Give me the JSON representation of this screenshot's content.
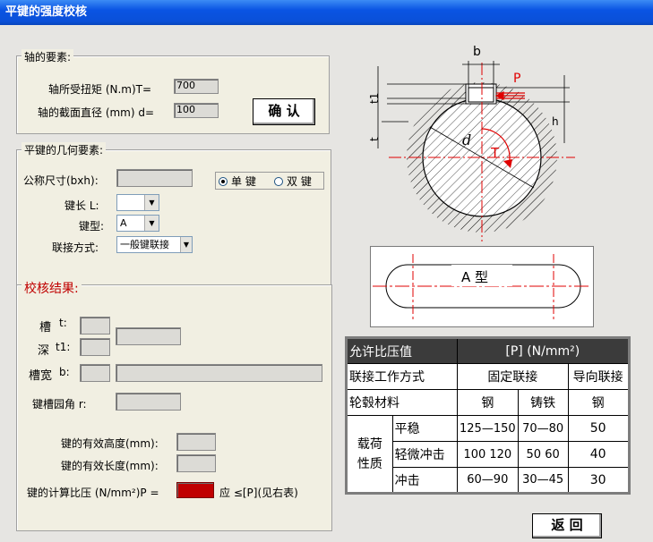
{
  "window": {
    "title": "平键的强度校核"
  },
  "shaft_group": {
    "label": "轴的要素:",
    "torque_label": "轴所受扭矩 (N.m)T=",
    "torque_value": "700",
    "diameter_label": "轴的截面直径 (mm) d=",
    "diameter_value": "100",
    "confirm_label": "确 认"
  },
  "key_group": {
    "label": "平键的几何要素:",
    "nominal_size_label": "公称尺寸(bxh):",
    "nominal_size_value": "",
    "length_label": "键长 L:",
    "length_value": "",
    "type_label": "键型:",
    "type_value": "A",
    "connection_label": "联接方式:",
    "connection_value": "一般键联接",
    "radio_single": "单 键",
    "radio_double": "双 键"
  },
  "result_group": {
    "label": "校核结果:",
    "groove_label_1": "槽",
    "groove_t_label": "t:",
    "depth_label": "深",
    "groove_t1_label": "t1:",
    "width_label": "槽宽",
    "width_b_label": "b:",
    "fillet_label": "键槽园角 r:",
    "eff_height_label": "键的有效高度(mm):",
    "eff_length_label": "键的有效长度(mm):",
    "calc_pressure_label": "键的计算比压 (N/mm²)P =",
    "should_label": "应 ≤[P](见右表)"
  },
  "figure": {
    "label_b": "b",
    "label_t1": "t1",
    "label_t": "t",
    "label_h": "h",
    "label_P": "P",
    "label_T": "T",
    "label_d": "d",
    "key_type_label": "A 型"
  },
  "table": {
    "header_left": "允许比压值",
    "header_right": "[P] (N/mm²)",
    "row_mode": {
      "label": "联接工作方式",
      "fixed": "固定联接",
      "sliding": "导向联接"
    },
    "row_material": {
      "label": "轮毂材料",
      "steel": "钢",
      "iron": "铸铁",
      "steel2": "钢"
    },
    "load_label_1": "载荷",
    "load_label_2": "性质",
    "rows": [
      {
        "name": "平稳",
        "steel": "125—150",
        "iron": "70—80",
        "sliding": "50"
      },
      {
        "name": "轻微冲击",
        "steel": "100  120",
        "iron": "50  60",
        "sliding": "40"
      },
      {
        "name": "冲击",
        "steel": "60—90",
        "iron": "30—45",
        "sliding": "30"
      }
    ]
  },
  "return_button": "返 回",
  "colors": {
    "titlebar": "#0a54e3",
    "result_label": "#c00000",
    "pressure_box": "#c00000",
    "table_header": "#3b3b3b"
  }
}
